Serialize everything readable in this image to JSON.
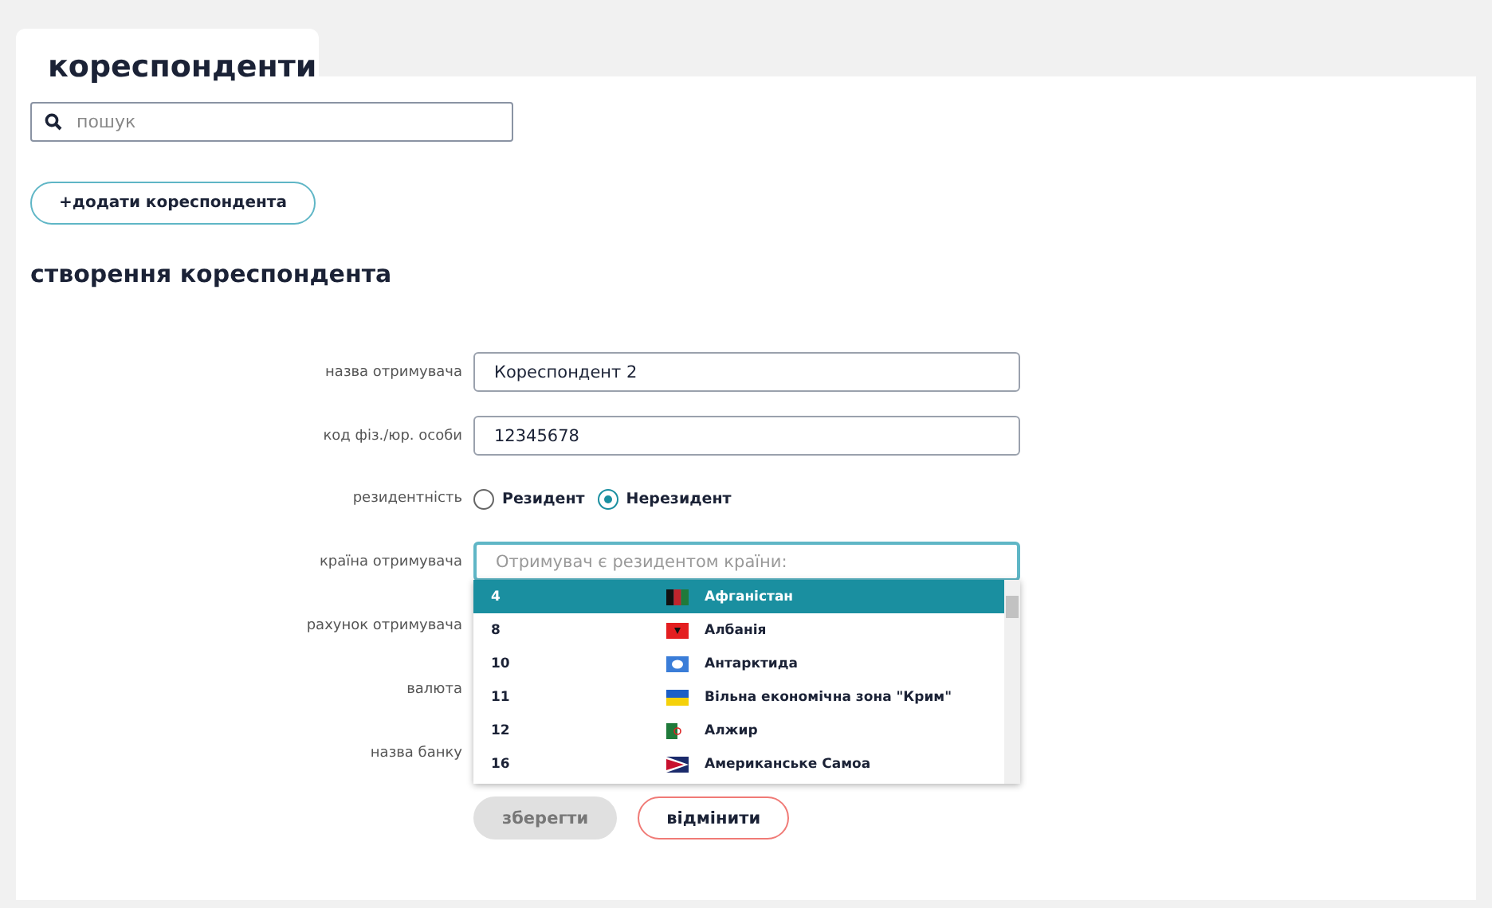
{
  "tab": {
    "title": "кореспонденти"
  },
  "search": {
    "placeholder": "пошук"
  },
  "add_button": "+додати кореспондента",
  "form": {
    "title": "створення кореспондента",
    "fields": [
      {
        "kind": "text",
        "label": "назва отримувача",
        "value": "Кореспондент 2"
      },
      {
        "kind": "text",
        "label": "код фіз./юр. особи",
        "value": "12345678"
      },
      {
        "kind": "radio",
        "label": "резидентність",
        "options": [
          {
            "label": "Резидент",
            "selected": false
          },
          {
            "label": "Нерезидент",
            "selected": true
          }
        ]
      },
      {
        "kind": "select",
        "label": "країна отримувача",
        "placeholder": "Отримувач є резидентом країни:",
        "expanded": true,
        "options": [
          {
            "code": "4",
            "name": "Афганістан",
            "selected": true,
            "kind": "af"
          },
          {
            "code": "8",
            "name": "Албанія",
            "selected": false,
            "kind": "al"
          },
          {
            "code": "10",
            "name": "Антарктида",
            "selected": false,
            "kind": "aq"
          },
          {
            "code": "11",
            "name": "Вільна економічна зона \"Крим\"",
            "selected": false,
            "kind": "ua"
          },
          {
            "code": "12",
            "name": "Алжир",
            "selected": false,
            "kind": "dz"
          },
          {
            "code": "16",
            "name": "Американське Самоа",
            "selected": false,
            "kind": "as"
          }
        ]
      },
      {
        "kind": "text",
        "label": "рахунок отримувача"
      },
      {
        "kind": "text",
        "label": "валюта"
      },
      {
        "kind": "text",
        "label": "назва банку"
      }
    ],
    "buttons": [
      {
        "label": "зберегти",
        "disabled": true
      },
      {
        "label": "відмінити",
        "disabled": false
      }
    ]
  }
}
